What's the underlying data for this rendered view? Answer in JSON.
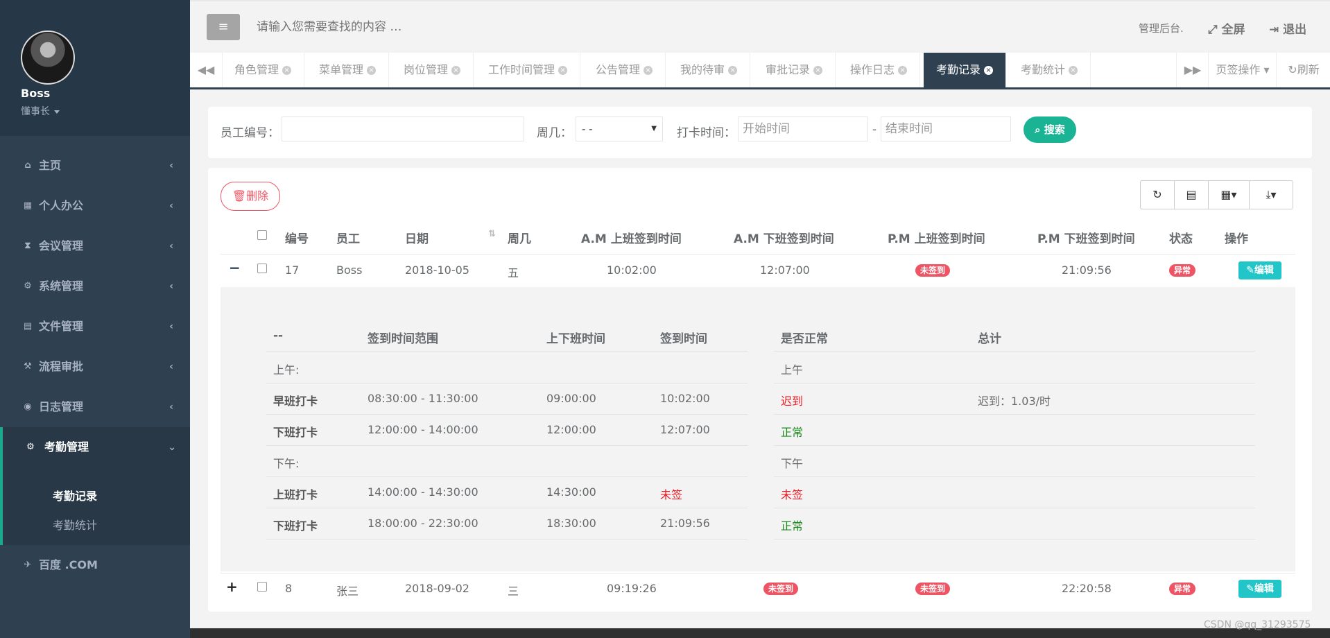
{
  "sidebar": {
    "user_name": "Boss",
    "user_role": "懂事长",
    "items": [
      {
        "icon": "home-icon",
        "glyph": "⌂",
        "label": "主页"
      },
      {
        "icon": "calendar-icon",
        "glyph": "▦",
        "label": "个人办公"
      },
      {
        "icon": "hourglass-icon",
        "glyph": "⧗",
        "label": "会议管理"
      },
      {
        "icon": "gear-icon",
        "glyph": "⚙",
        "label": "系统管理"
      },
      {
        "icon": "file-icon",
        "glyph": "▤",
        "label": "文件管理"
      },
      {
        "icon": "gavel-icon",
        "glyph": "⚒",
        "label": "流程审批"
      },
      {
        "icon": "eye-icon",
        "glyph": "◉",
        "label": "日志管理"
      },
      {
        "icon": "cogs-icon",
        "glyph": "⚙",
        "label": "考勤管理"
      }
    ],
    "sub_items": [
      "考勤记录",
      "考勤统计"
    ],
    "link": {
      "icon": "plane-icon",
      "glyph": "✈",
      "label": "百度 .COM"
    }
  },
  "topbar": {
    "search_placeholder": "请输入您需要查找的内容 …",
    "admin_label": "管理后台.",
    "fullscreen_label": "全屏",
    "logout_label": "退出"
  },
  "tabs": [
    "角色管理",
    "菜单管理",
    "岗位管理",
    "工作时间管理",
    "公告管理",
    "我的待审",
    "审批记录",
    "操作日志",
    "考勤记录",
    "考勤统计"
  ],
  "tab_actions": {
    "page_ops": "页签操作",
    "refresh": "刷新"
  },
  "filters": {
    "emp_no_label": "员工编号：",
    "weekday_label": "周几：",
    "weekday_value": "- -",
    "punch_label": "打卡时间：",
    "start_placeholder": "开始时间",
    "end_placeholder": "结束时间",
    "separator": "-",
    "search_label": "搜索"
  },
  "toolbar": {
    "delete_label": "删除"
  },
  "table": {
    "headers": [
      "编号",
      "员工",
      "日期",
      "周几",
      "A.M 上班签到时间",
      "A.M 下班签到时间",
      "P.M 上班签到时间",
      "P.M 下班签到时间",
      "状态",
      "操作"
    ],
    "rows": [
      {
        "id": "17",
        "employee": "Boss",
        "date": "2018-10-05",
        "weekday": "五",
        "am_in": "10:02:00",
        "am_out": "12:07:00",
        "pm_in": "未签到",
        "pm_out": "21:09:56",
        "status": "异常",
        "action": "编辑",
        "expander": "−"
      },
      {
        "id": "8",
        "employee": "张三",
        "date": "2018-09-02",
        "weekday": "三",
        "am_in": "09:19:26",
        "am_out": "未签到",
        "pm_in": "未签到",
        "pm_out": "22:20:58",
        "status": "异常",
        "action": "编辑",
        "expander": "+"
      }
    ]
  },
  "detail": {
    "headers": [
      "--",
      "签到时间范围",
      "上下班时间",
      "签到时间",
      "是否正常",
      "总计"
    ],
    "am_label": "上午:",
    "am_label2": "上午",
    "pm_label": "下午:",
    "pm_label2": "下午",
    "rows": [
      {
        "name": "早班打卡",
        "range": "08:30:00 - 11:30:00",
        "shift": "09:00:00",
        "sign": "10:02:00",
        "normal": "迟到",
        "total": "迟到：1.03/时"
      },
      {
        "name": "下班打卡",
        "range": "12:00:00 - 14:00:00",
        "shift": "12:00:00",
        "sign": "12:07:00",
        "normal": "正常",
        "total": ""
      },
      {
        "name": "上班打卡",
        "range": "14:00:00 - 14:30:00",
        "shift": "14:30:00",
        "sign": "未签",
        "normal": "未签",
        "total": ""
      },
      {
        "name": "下班打卡",
        "range": "18:00:00 - 22:30:00",
        "shift": "18:30:00",
        "sign": "21:09:56",
        "normal": "正常",
        "total": ""
      }
    ]
  },
  "watermark": "CSDN @qq_31293575",
  "colors": {
    "sidebar": "#2f4050",
    "accent": "#1ab394",
    "danger": "#ed5565",
    "info": "#23c6c8"
  }
}
